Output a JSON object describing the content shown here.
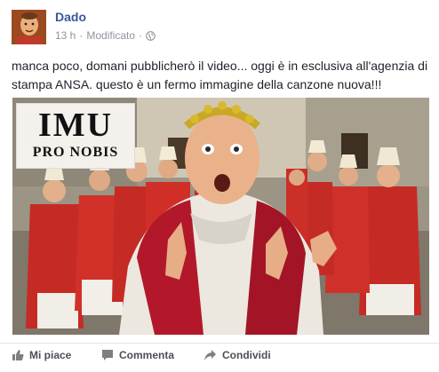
{
  "post": {
    "author": "Dado",
    "time": "13 h",
    "separator": "·",
    "edited": "Modificato",
    "privacy_icon": "globe-icon",
    "text": "manca poco, domani pubblicherò il video... oggi è in esclusiva all'agenzia di stampa ANSA. questo è un fermo immagine della canzone nuova!!!"
  },
  "image": {
    "overlay_title": "IMU",
    "overlay_subtitle": "PRO NOBIS"
  },
  "actions": {
    "like": {
      "label": "Mi piace",
      "icon": "thumbs-up-icon"
    },
    "comment": {
      "label": "Commenta",
      "icon": "comment-icon"
    },
    "share": {
      "label": "Condividi",
      "icon": "share-icon"
    }
  },
  "colors": {
    "author_link": "#365899",
    "meta_gray": "#90949c",
    "action_gray": "#4b4f56"
  }
}
